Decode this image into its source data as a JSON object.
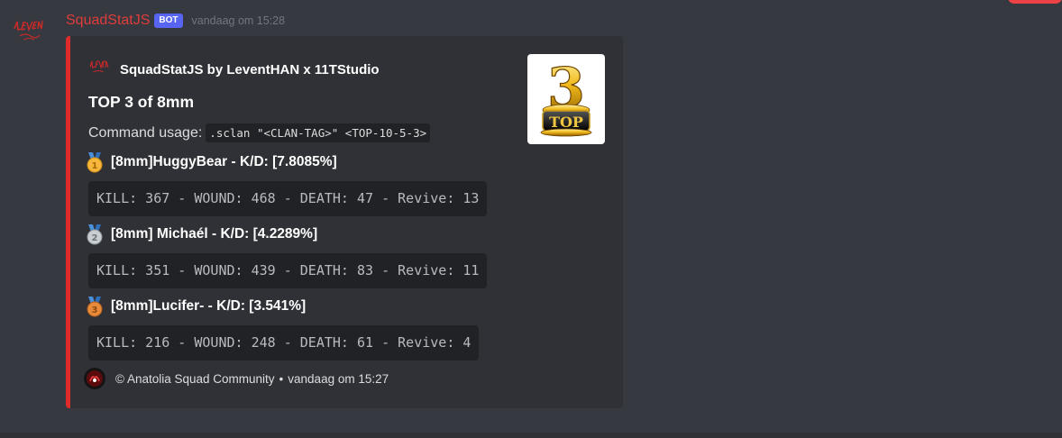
{
  "message": {
    "username": "SquadStatJS",
    "bot_tag": "BOT",
    "timestamp": "vandaag om 15:28",
    "avatar_icon": "levent-studio-logo",
    "username_color": "#e03c3c"
  },
  "embed": {
    "accent_color": "#e02b2b",
    "author": {
      "name": "SquadStatJS by LeventHAN x 11TStudio",
      "icon": "levent-studio-logo"
    },
    "title": "TOP 3 of 8mm",
    "description": {
      "text": "Command usage:",
      "code": ".sclan \"<CLAN-TAG>\" <TOP-10-5-3>"
    },
    "thumbnail": {
      "icon": "top-3-trophy-image",
      "number": "3",
      "label": "TOP"
    },
    "fields": [
      {
        "medal": "gold-medal-icon",
        "medal_number": "1",
        "name": "[8mm]HuggyBear - K/D: [7.8085%]",
        "value": "KILL: 367 - WOUND: 468 - DEATH: 47 - Revive: 13"
      },
      {
        "medal": "silver-medal-icon",
        "medal_number": "2",
        "name": "[8mm] Michaél - K/D: [4.2289%]",
        "value": "KILL: 351 - WOUND: 439 - DEATH: 83 - Revive: 11"
      },
      {
        "medal": "bronze-medal-icon",
        "medal_number": "3",
        "name": "[8mm]Lucifer- - K/D: [3.541%]",
        "value": "KILL: 216 - WOUND: 248 - DEATH: 61 - Revive: 4"
      }
    ],
    "footer": {
      "icon": "anatolia-squad-community-icon",
      "text": "© Anatolia Squad Community",
      "separator": "•",
      "timestamp": "vandaag om 15:27"
    }
  }
}
